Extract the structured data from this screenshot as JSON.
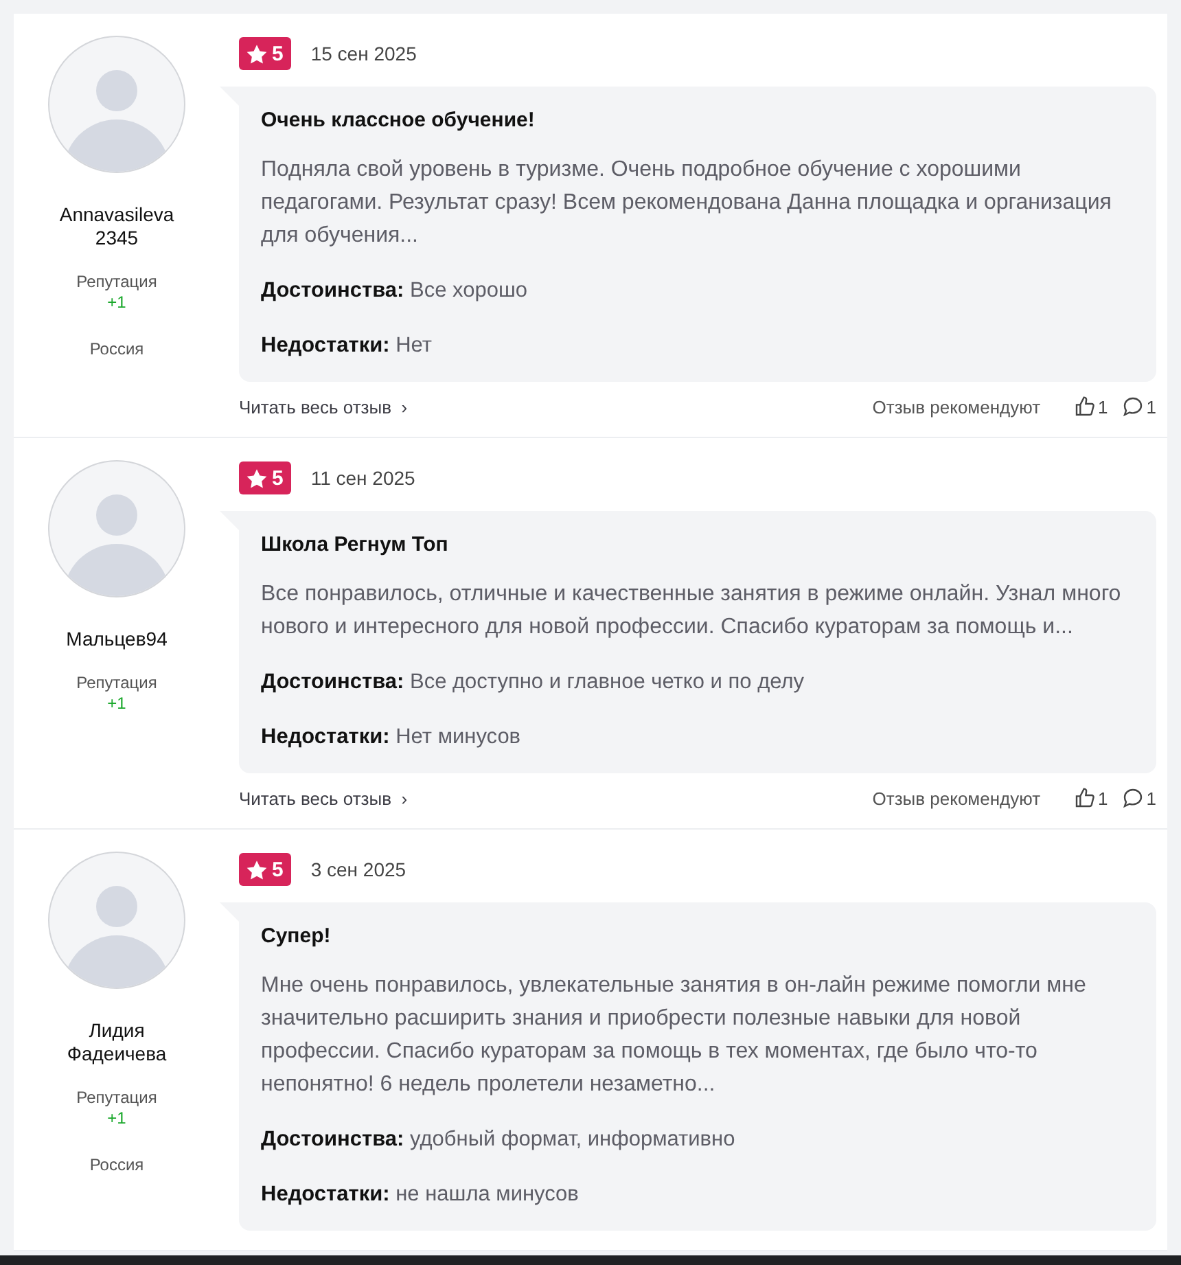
{
  "reviews": [
    {
      "author": "Annavasileva 2345",
      "reputation_label": "Репутация",
      "reputation": "+1",
      "country": "Россия",
      "rating": "5",
      "date": "15 сен 2025",
      "title": "Очень классное обучение!",
      "text": "Подняла свой уровень в туризме. Очень подробное обучение с хорошими педагогами. Результат сразу! Всем рекомендована Данна площадка и организация для обучения...",
      "pros_label": "Достоинства:",
      "pros": "Все хорошо",
      "cons_label": "Недостатки:",
      "cons": "Нет",
      "footer": {
        "read_more": "Читать весь отзыв",
        "arrow": "›",
        "recommend_label": "Отзыв рекомендуют",
        "likes": "1",
        "comments": "1"
      }
    },
    {
      "author": "Мальцев94",
      "reputation_label": "Репутация",
      "reputation": "+1",
      "rating": "5",
      "date": "11 сен 2025",
      "title": "Школа Регнум Топ",
      "text": "Все понравилось, отличные и качественные занятия в режиме онлайн. Узнал много нового и интересного для новой профессии. Спасибо кураторам за помощь и...",
      "pros_label": "Достоинства:",
      "pros": "Все доступно и главное четко и по делу",
      "cons_label": "Недостатки:",
      "cons": "Нет минусов",
      "footer": {
        "read_more": "Читать весь отзыв",
        "arrow": "›",
        "recommend_label": "Отзыв рекомендуют",
        "likes": "1",
        "comments": "1"
      }
    },
    {
      "author": "Лидия Фадеичева",
      "reputation_label": "Репутация",
      "reputation": "+1",
      "country": "Россия",
      "rating": "5",
      "date": "3 сен 2025",
      "title": "Супер!",
      "text": "Мне очень понравилось, увлекательные занятия в он-лайн режиме помогли мне значительно расширить знания и приобрести полезные навыки для новой профессии. Спасибо кураторам за помощь в тех моментах, где было что-то непонятно! 6 недель пролетели незаметно...",
      "pros_label": "Достоинства:",
      "pros": "удобный формат, информативно",
      "cons_label": "Недостатки:",
      "cons": "не нашла минусов"
    }
  ]
}
